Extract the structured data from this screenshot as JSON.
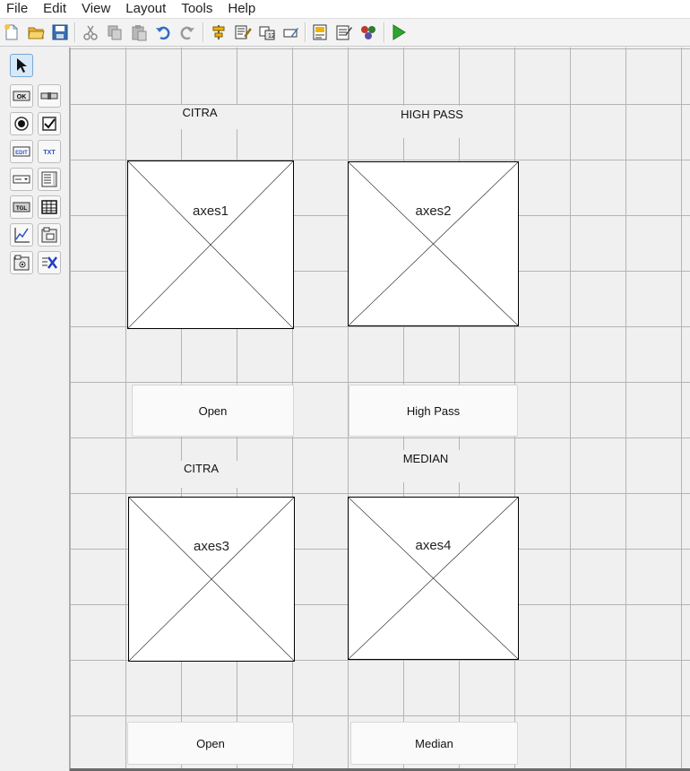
{
  "menu": {
    "items": [
      "File",
      "Edit",
      "View",
      "Layout",
      "Tools",
      "Help"
    ]
  },
  "toolbar": {
    "icons": [
      "new-file-icon",
      "open-folder-icon",
      "save-icon",
      "cut-icon",
      "copy-icon",
      "paste-icon",
      "undo-icon",
      "redo-icon",
      "align-objects-icon",
      "menu-editor-icon",
      "tab-order-editor-icon",
      "toolbar-editor-icon",
      "editor-icon",
      "property-inspector-icon",
      "object-browser-icon",
      "run-figure-icon"
    ]
  },
  "palette": {
    "tools": [
      "select-tool",
      "push-button-tool",
      "slider-tool",
      "radio-button-tool",
      "check-box-tool",
      "edit-text-tool",
      "static-text-tool",
      "popup-menu-tool",
      "listbox-tool",
      "toggle-button-tool",
      "table-tool",
      "axes-tool",
      "panel-tool",
      "button-group-tool",
      "activex-control-tool"
    ],
    "glyphs": {
      "push_button": "OK",
      "edit_text": "EDIT",
      "static_text": "TXT",
      "toggle_button": "TGL"
    }
  },
  "canvas": {
    "labels": {
      "citra_top": "CITRA",
      "high_pass": "HIGH PASS",
      "citra_bottom": "CITRA",
      "median": "MEDIAN"
    },
    "axes": {
      "axes1": "axes1",
      "axes2": "axes2",
      "axes3": "axes3",
      "axes4": "axes4"
    },
    "buttons": {
      "open_top": "Open",
      "high_pass": "High Pass",
      "open_bottom": "Open",
      "median": "Median"
    }
  }
}
